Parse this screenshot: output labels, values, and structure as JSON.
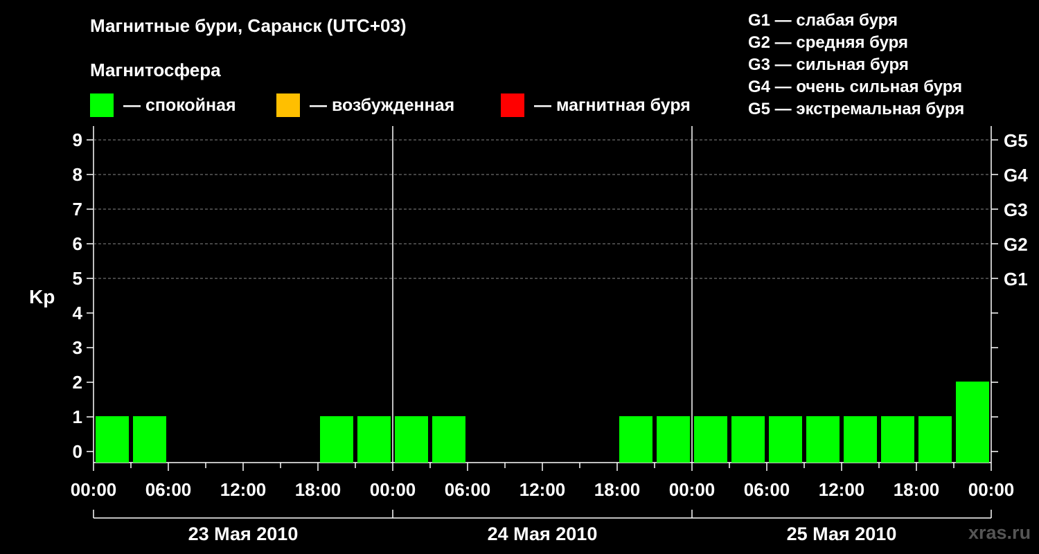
{
  "header": {
    "title": "Магнитные бури, Саранск (UTC+03)",
    "subtitle": "Магнитосфера"
  },
  "legend": [
    {
      "label": "— спокойная",
      "color": "#00ff00"
    },
    {
      "label": "— возбужденная",
      "color": "#ffbf00"
    },
    {
      "label": "— магнитная буря",
      "color": "#ff0000"
    }
  ],
  "g_scale_legend": [
    "G1 — слабая буря",
    "G2 — средняя буря",
    "G3 — сильная буря",
    "G4 — очень сильная буря",
    "G5 — экстремальная буря"
  ],
  "watermark": "xras.ru",
  "chart_data": {
    "type": "bar",
    "ylabel": "Kp",
    "ylim": [
      0,
      9
    ],
    "y_ticks": [
      "0",
      "1",
      "2",
      "3",
      "4",
      "5",
      "6",
      "7",
      "8",
      "9"
    ],
    "right_axis_ticks": [
      {
        "kp": 5,
        "label": "G1"
      },
      {
        "kp": 6,
        "label": "G2"
      },
      {
        "kp": 7,
        "label": "G3"
      },
      {
        "kp": 8,
        "label": "G4"
      },
      {
        "kp": 9,
        "label": "G5"
      }
    ],
    "grid": "dashed horizontal lines at Kp 5–9",
    "x_tick_labels": [
      "00:00",
      "06:00",
      "12:00",
      "18:00",
      "00:00",
      "06:00",
      "12:00",
      "18:00",
      "00:00",
      "06:00",
      "12:00",
      "18:00",
      "00:00"
    ],
    "days": [
      "23 Мая 2010",
      "24 Мая 2010",
      "25 Мая 2010"
    ],
    "interval": "3 hours",
    "bar_color": "#00ff00",
    "values": [
      1,
      1,
      0,
      0,
      0,
      0,
      1,
      1,
      1,
      1,
      0,
      0,
      0,
      0,
      1,
      1,
      1,
      1,
      1,
      1,
      1,
      1,
      1,
      2
    ]
  }
}
